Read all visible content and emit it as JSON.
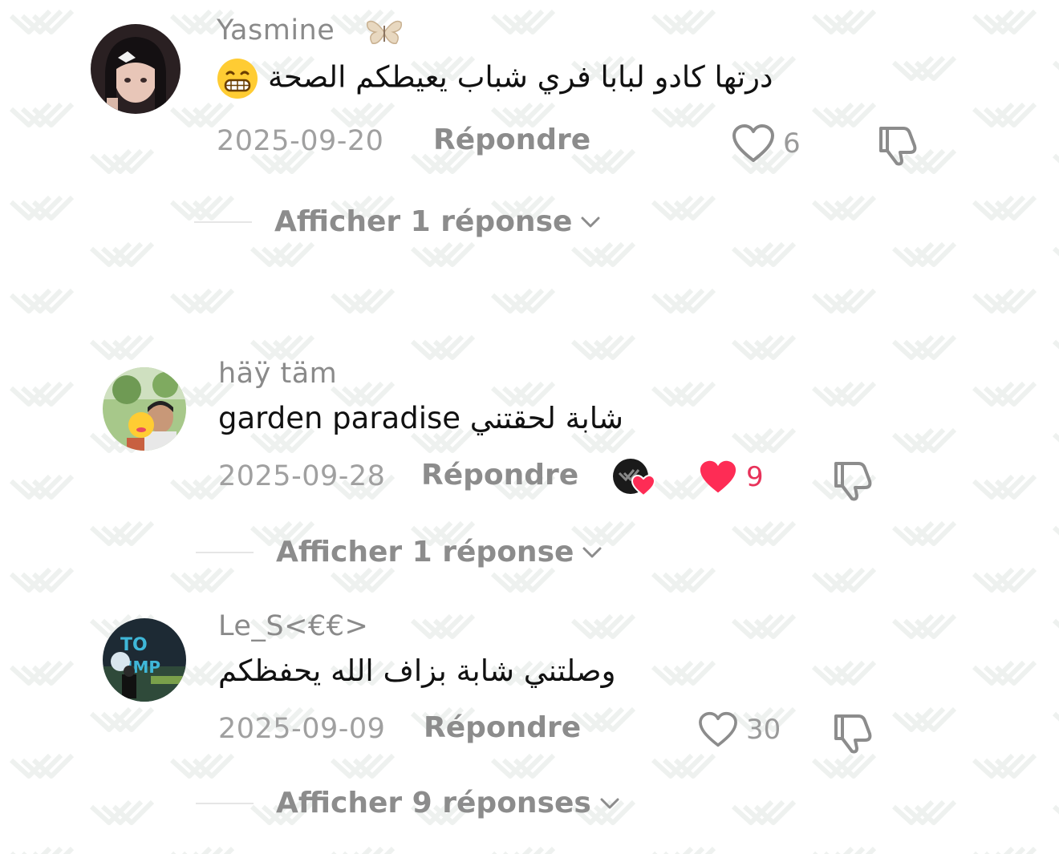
{
  "comments": [
    {
      "username": "Yasmine",
      "text": "درتها كادو لبابا فري شباب يعيطكم الصحة",
      "emoji": "grinning-face",
      "date": "2025-09-20",
      "reply_label": "Répondre",
      "likes": "6",
      "liked": false,
      "show_replies_label": "Afficher 1 réponse"
    },
    {
      "username": "häÿ täm",
      "text": "garden paradise شابة لحقتني",
      "date": "2025-09-28",
      "reply_label": "Répondre",
      "likes": "9",
      "liked": true,
      "creator_liked": true,
      "show_replies_label": "Afficher 1 réponse"
    },
    {
      "username": "Le_S<€€>",
      "text": "وصلتني شابة بزاف الله يحفظكم",
      "date": "2025-09-09",
      "reply_label": "Répondre",
      "likes": "30",
      "liked": false,
      "show_replies_label": "Afficher 9 réponses"
    }
  ],
  "colors": {
    "like_active": "#fe2c55",
    "secondary_text": "#8c8c8c",
    "primary_text": "#111111"
  }
}
